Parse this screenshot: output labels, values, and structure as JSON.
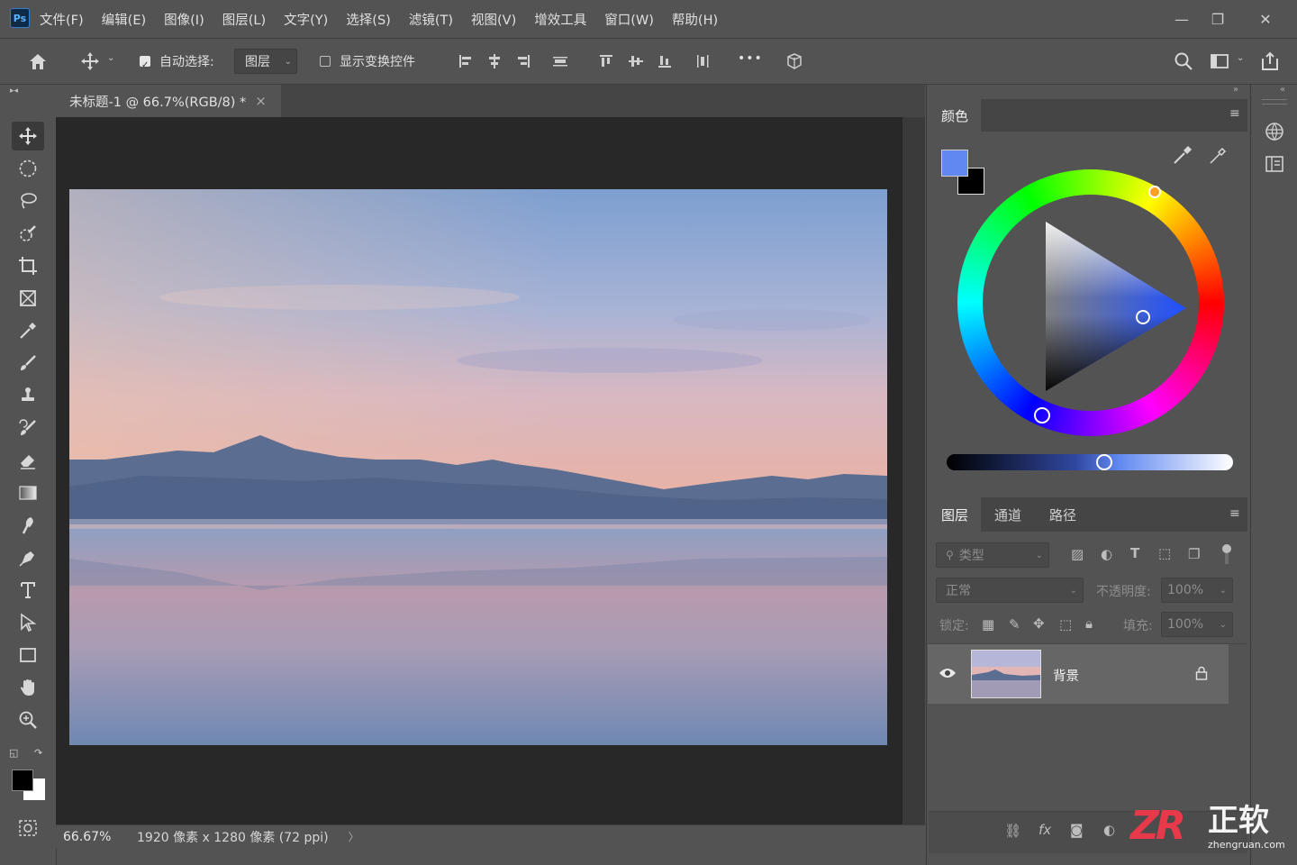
{
  "app": {
    "logo": "Ps"
  },
  "menu": {
    "items": [
      "文件(F)",
      "编辑(E)",
      "图像(I)",
      "图层(L)",
      "文字(Y)",
      "选择(S)",
      "滤镜(T)",
      "视图(V)",
      "增效工具",
      "窗口(W)",
      "帮助(H)"
    ]
  },
  "window_controls": {
    "minimize": "—",
    "maximize": "❐",
    "close": "✕"
  },
  "options_bar": {
    "auto_select_label": "自动选择:",
    "auto_select_checked": true,
    "auto_select_target": "图层",
    "show_transform_label": "显示变换控件",
    "show_transform_checked": false,
    "more": "•••"
  },
  "document": {
    "tab_title": "未标题-1 @ 66.7%(RGB/8) *",
    "tab_close": "×",
    "zoom": "66.67%",
    "dimensions": "1920 像素 x 1280 像素 (72 ppi)",
    "status_arrow": "〉"
  },
  "color_panel": {
    "tab": "颜色",
    "foreground": "#6088f0",
    "background": "#000000"
  },
  "layers_panel": {
    "tabs": [
      "图层",
      "通道",
      "路径"
    ],
    "active_tab": "图层",
    "filter_placeholder": "类型",
    "blend_mode": "正常",
    "opacity_label": "不透明度:",
    "opacity_value": "100%",
    "lock_label": "锁定:",
    "fill_label": "填充:",
    "fill_value": "100%",
    "layers": [
      {
        "name": "背景",
        "visible": true,
        "locked": true
      }
    ]
  },
  "watermark": {
    "brand": "正软",
    "url": "zhengruan.com",
    "logo": "ZR"
  }
}
